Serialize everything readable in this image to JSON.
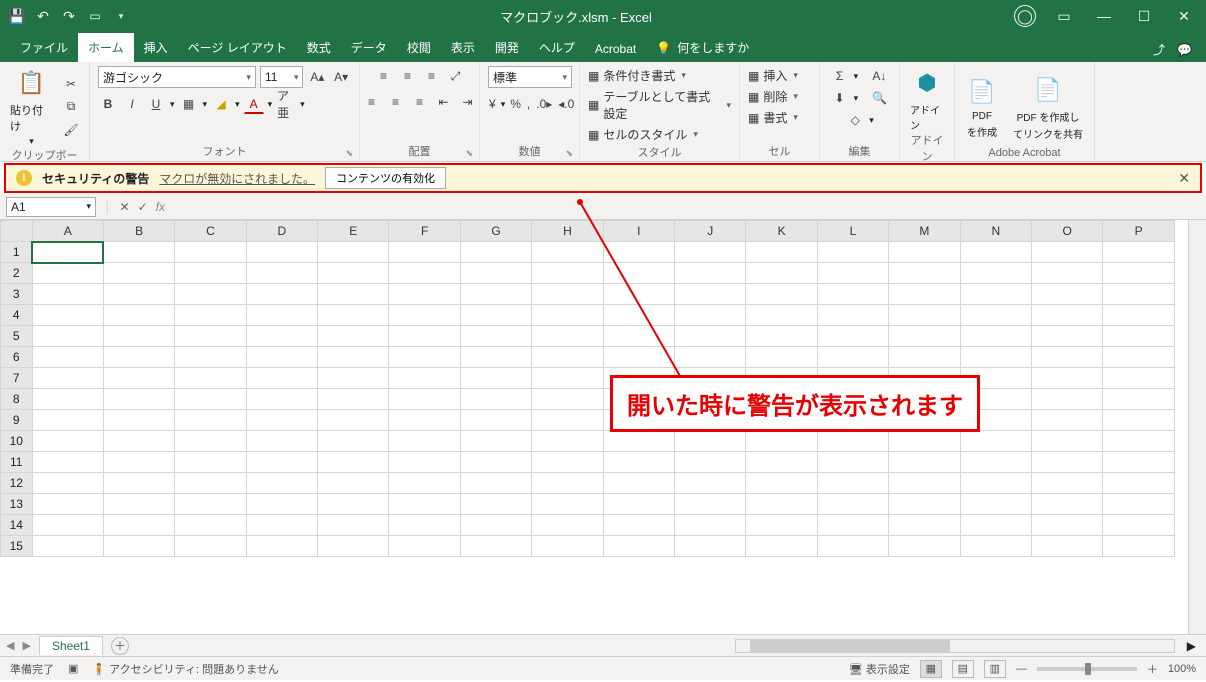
{
  "title": "マクロブック.xlsm  -  Excel",
  "tabs": {
    "file": "ファイル",
    "home": "ホーム",
    "insert": "挿入",
    "layout": "ページ レイアウト",
    "formulas": "数式",
    "data": "データ",
    "review": "校閲",
    "view": "表示",
    "developer": "開発",
    "help": "ヘルプ",
    "acrobat": "Acrobat",
    "tellme": "何をしますか"
  },
  "ribbon": {
    "clipboard": {
      "label": "クリップボード",
      "paste": "貼り付け"
    },
    "font": {
      "label": "フォント",
      "name": "游ゴシック",
      "size": "11"
    },
    "alignment": {
      "label": "配置"
    },
    "number": {
      "label": "数値",
      "format": "標準"
    },
    "styles": {
      "label": "スタイル",
      "cond": "条件付き書式",
      "tablefmt": "テーブルとして書式設定",
      "cellstyle": "セルのスタイル"
    },
    "cells": {
      "label": "セル",
      "insert": "挿入",
      "delete": "削除",
      "format": "書式"
    },
    "editing": {
      "label": "編集"
    },
    "addin": {
      "label": "アドイン",
      "btn": "アドイン"
    },
    "acrobat": {
      "label": "Adobe Acrobat",
      "pdf1a": "PDF",
      "pdf1b": "を作成",
      "pdf2a": "PDF を作成し",
      "pdf2b": "てリンクを共有"
    }
  },
  "security": {
    "title": "セキュリティの警告",
    "msg": "マクロが無効にされました。",
    "btn": "コンテンツの有効化"
  },
  "namebox": "A1",
  "columns": [
    "A",
    "B",
    "C",
    "D",
    "E",
    "F",
    "G",
    "H",
    "I",
    "J",
    "K",
    "L",
    "M",
    "N",
    "O",
    "P"
  ],
  "rows": [
    "1",
    "2",
    "3",
    "4",
    "5",
    "6",
    "7",
    "8",
    "9",
    "10",
    "11",
    "12",
    "13",
    "14",
    "15"
  ],
  "sheet": "Sheet1",
  "status": {
    "ready": "準備完了",
    "acc": "アクセシビリティ: 問題ありません",
    "display": "表示設定",
    "zoom": "100%"
  },
  "callout": "開いた時に警告が表示されます"
}
